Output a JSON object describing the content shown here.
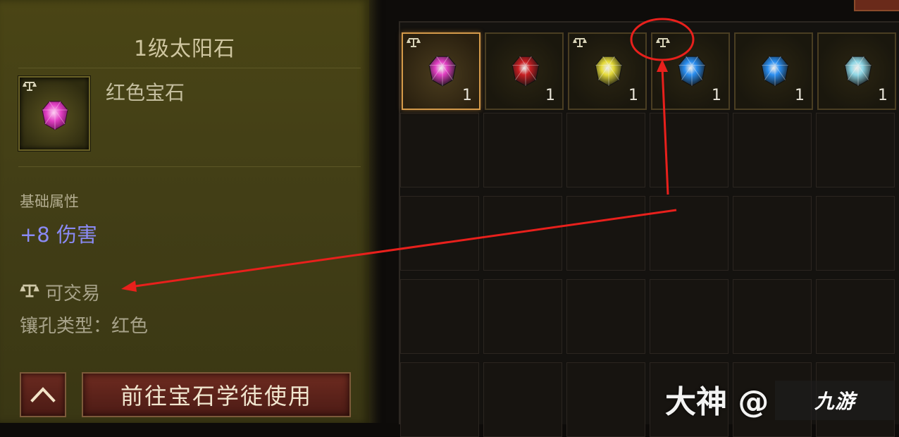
{
  "tooltip": {
    "title": "1级太阳石",
    "item_type": "红色宝石",
    "base_attr_label": "基础属性",
    "damage": "+8 伤害",
    "tradeable": "可交易",
    "socket_type": "镶孔类型：红色",
    "go_button": "前往宝石学徒使用",
    "up_icon": "chevron-up-icon",
    "trade_icon": "scale-icon",
    "gem_color": "#e23fc3"
  },
  "inventory": {
    "slots": [
      {
        "color": "#e23fc3",
        "count": "1",
        "tradeable": true,
        "selected": true
      },
      {
        "color": "#c81e22",
        "count": "1",
        "tradeable": false,
        "selected": false
      },
      {
        "color": "#e6dc3a",
        "count": "1",
        "tradeable": true,
        "selected": false
      },
      {
        "color": "#2a8ef0",
        "count": "1",
        "tradeable": true,
        "selected": false
      },
      {
        "color": "#2a8ef0",
        "count": "1",
        "tradeable": false,
        "selected": false
      },
      {
        "color": "#8fd7e6",
        "count": "1",
        "tradeable": false,
        "selected": false
      }
    ]
  },
  "watermark": {
    "text": "大神 @",
    "logo": "九游"
  },
  "colors": {
    "annotation": "#e8201c",
    "panel_bg": "#4a4515",
    "damage_text": "#8a8af5"
  }
}
